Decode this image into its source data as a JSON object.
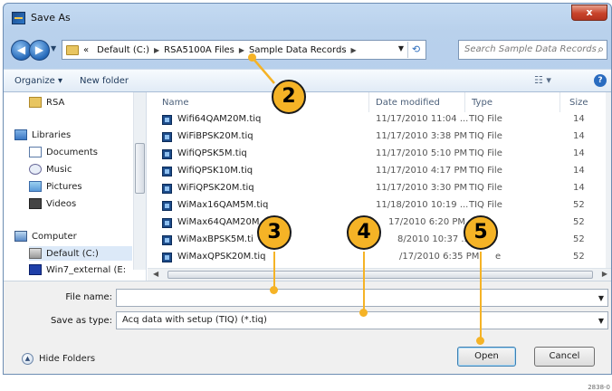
{
  "window": {
    "title": "Save As",
    "close_label": "x"
  },
  "navigation": {
    "back_glyph": "◀",
    "forward_glyph": "▶",
    "breadcrumbs": [
      "«",
      "Default (C:)",
      "RSA5100A Files",
      "Sample Data Records"
    ],
    "search_placeholder": "Search Sample Data Records"
  },
  "toolbar": {
    "organize_label": "Organize ▾",
    "new_folder_label": "New folder",
    "views_glyph": "☷ ▾",
    "help_glyph": "?"
  },
  "sidebar": {
    "items": [
      {
        "label": "RSA",
        "icon": "folder-icon"
      },
      {
        "label": "Libraries",
        "icon": "libraries-icon"
      },
      {
        "label": "Documents",
        "icon": "documents-icon"
      },
      {
        "label": "Music",
        "icon": "music-icon"
      },
      {
        "label": "Pictures",
        "icon": "pictures-icon"
      },
      {
        "label": "Videos",
        "icon": "videos-icon"
      },
      {
        "label": "Computer",
        "icon": "computer-icon"
      },
      {
        "label": "Default (C:)",
        "icon": "drive-icon"
      },
      {
        "label": "Win7_external (E:",
        "icon": "external-drive-icon"
      }
    ]
  },
  "file_list": {
    "columns": [
      "Name",
      "Date modified",
      "Type",
      "Size"
    ],
    "rows": [
      {
        "name": "Wifi64QAM20M.tiq",
        "date": "11/17/2010 11:04 ...",
        "type": "TIQ File",
        "size": "14"
      },
      {
        "name": "WiFiBPSK20M.tiq",
        "date": "11/17/2010 3:38 PM",
        "type": "TIQ File",
        "size": "14"
      },
      {
        "name": "WifiQPSK5M.tiq",
        "date": "11/17/2010 5:10 PM",
        "type": "TIQ File",
        "size": "14"
      },
      {
        "name": "WifiQPSK10M.tiq",
        "date": "11/17/2010 4:17 PM",
        "type": "TIQ File",
        "size": "14"
      },
      {
        "name": "WiFiQPSK20M.tiq",
        "date": "11/17/2010 3:30 PM",
        "type": "TIQ File",
        "size": "14"
      },
      {
        "name": "WiMax16QAM5M.tiq",
        "date": "11/18/2010 10:19 ...",
        "type": "TIQ File",
        "size": "52"
      },
      {
        "name": "WiMax64QAM20M",
        "date": "17/2010 6:20 PM",
        "type": "",
        "size": "52"
      },
      {
        "name": "WiMaxBPSK5M.ti",
        "date": "8/2010 10:37 ...",
        "type": "",
        "size": "52"
      },
      {
        "name": "WiMaxQPSK20M.tiq",
        "date": "/17/2010 6:35 PM",
        "type": "e",
        "size": "52"
      }
    ]
  },
  "form": {
    "file_name_label": "File name:",
    "file_name_value": "",
    "save_as_type_label": "Save as type:",
    "save_as_type_value": "Acq data with setup (TIQ) (*.tiq)",
    "hide_folders_label": "Hide Folders",
    "open_label": "Open",
    "cancel_label": "Cancel"
  },
  "callouts": [
    "2",
    "3",
    "4",
    "5"
  ],
  "figure_code": "2838-0"
}
